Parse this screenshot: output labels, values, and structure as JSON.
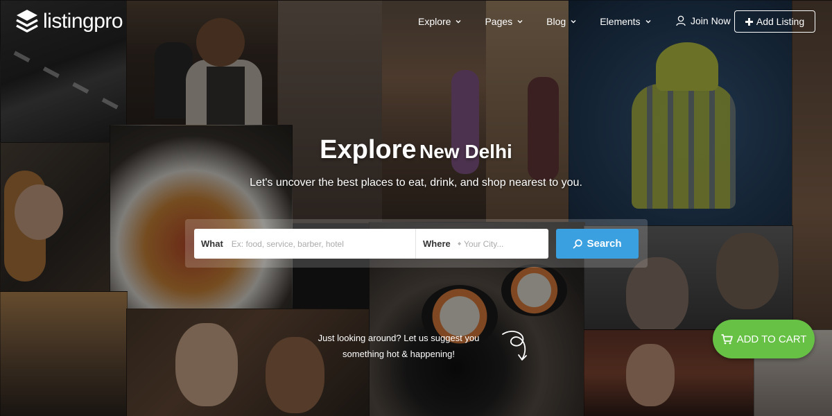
{
  "brand": {
    "name": "listingpro"
  },
  "nav": {
    "items": [
      {
        "label": "Explore"
      },
      {
        "label": "Pages"
      },
      {
        "label": "Blog"
      },
      {
        "label": "Elements"
      }
    ],
    "join_label": "Join Now",
    "add_listing_label": "Add Listing"
  },
  "hero": {
    "title_prefix": "Explore",
    "title_city": "New Delhi",
    "subtitle": "Let's uncover the best places to eat, drink, and shop nearest to you."
  },
  "search": {
    "what_label": "What",
    "what_placeholder": "Ex: food, service, barber, hotel",
    "where_label": "Where",
    "where_placeholder": "Your City...",
    "button_label": "Search"
  },
  "suggest": {
    "line1": "Just looking around? Let us suggest you",
    "line2": "something hot & happening!"
  },
  "cart": {
    "label": "ADD TO CART"
  },
  "colors": {
    "search_button": "#3aa0e0",
    "cart_button": "#66c145",
    "text": "#ffffff"
  },
  "icons": [
    "logo-mark-icon",
    "chevron-down-icon",
    "user-icon",
    "plus-icon",
    "crosshair-icon",
    "search-icon",
    "swirl-arrow-icon",
    "cart-icon"
  ]
}
